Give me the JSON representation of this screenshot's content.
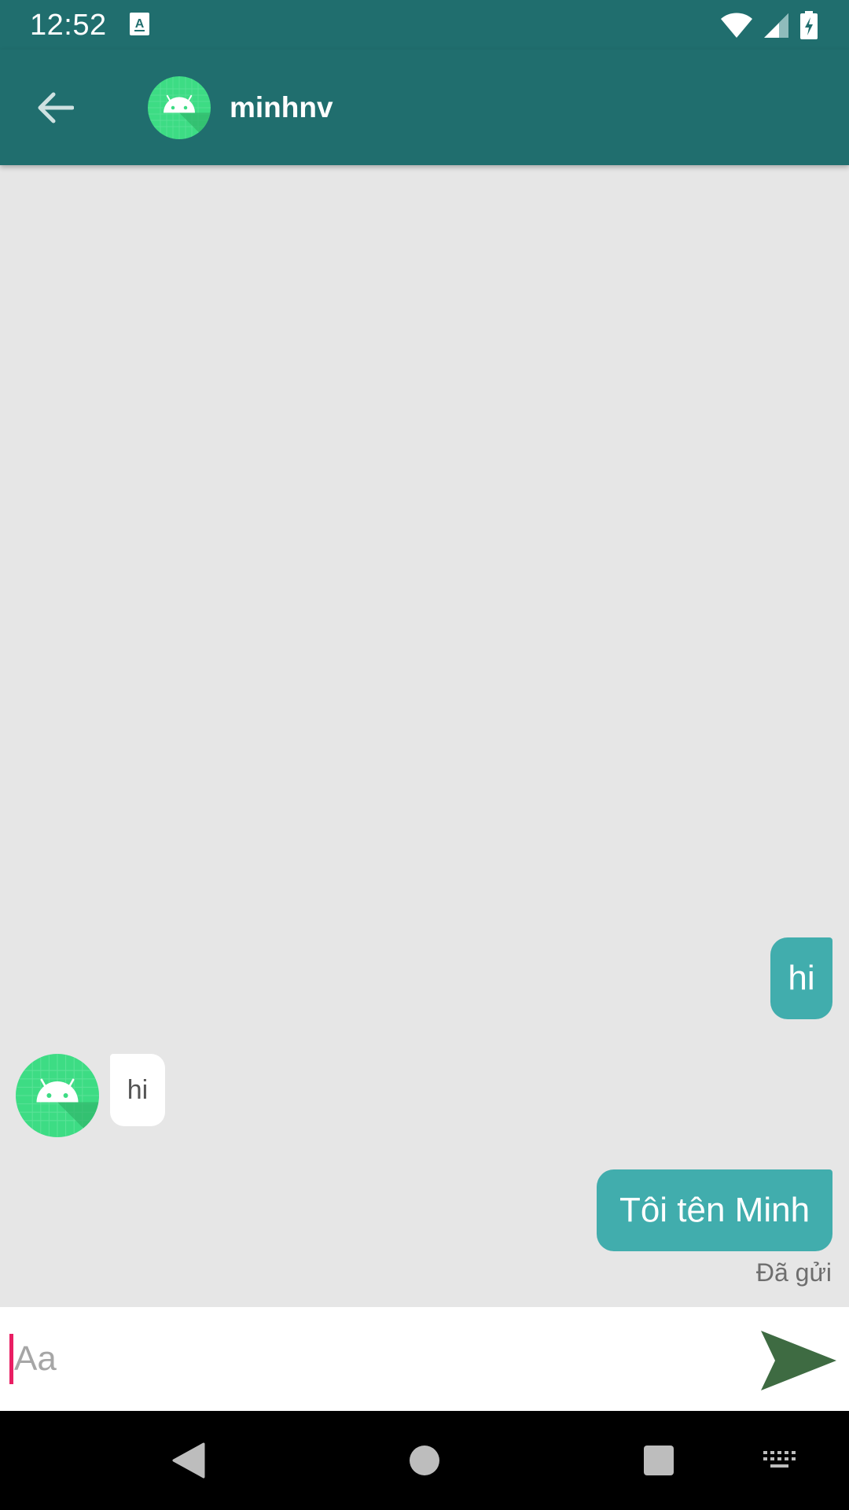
{
  "status_bar": {
    "time": "12:52",
    "icons": [
      "keyboard-a-icon",
      "wifi-icon",
      "signal-icon",
      "battery-charging-icon"
    ]
  },
  "toolbar": {
    "title": "minhnv",
    "back_icon": "arrow-back-icon",
    "avatar_icon": "android-avatar-icon"
  },
  "messages": [
    {
      "direction": "out",
      "text": "hi"
    },
    {
      "direction": "in",
      "text": "hi"
    },
    {
      "direction": "out",
      "text": "Tôi tên Minh",
      "status": "Đã gửi"
    }
  ],
  "composer": {
    "placeholder": "Aa",
    "value": "",
    "send_icon": "send-icon"
  },
  "navbar": {
    "icons": [
      "back-triangle-icon",
      "home-circle-icon",
      "recents-square-icon",
      "keyboard-icon"
    ]
  },
  "colors": {
    "header": "#206e6e",
    "outgoing_bubble": "#41adad",
    "incoming_bubble": "#ffffff",
    "chat_background": "#e6e6e6",
    "send_button": "#3e6b42",
    "avatar_green": "#3ddc84"
  }
}
